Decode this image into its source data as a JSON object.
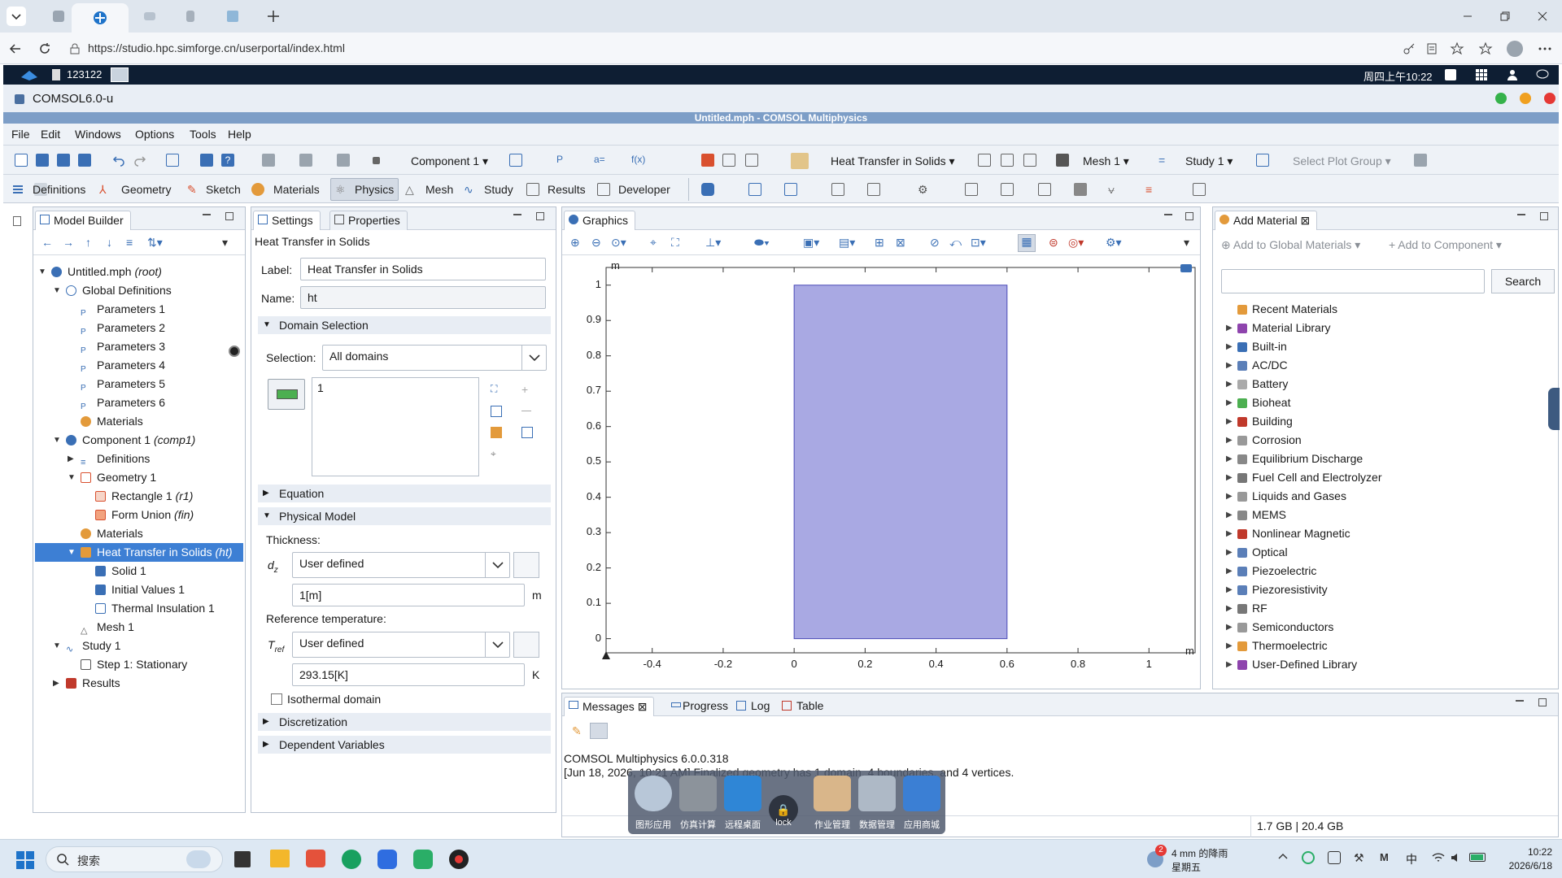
{
  "browser": {
    "url": "https://studio.hpc.simforge.cn/userportal/index.html"
  },
  "remote": {
    "session_id": "123122",
    "clock": "周四上午10:22"
  },
  "comsol_app": {
    "title": "COMSOL6.0-u",
    "window_title": "Untitled.mph - COMSOL Multiphysics"
  },
  "menu": {
    "items": [
      "File",
      "Edit",
      "Windows",
      "Options",
      "Tools",
      "Help"
    ]
  },
  "toolbar": {
    "component": "Component 1",
    "physics": "Heat Transfer in Solids",
    "mesh": "Mesh 1",
    "study": "Study 1",
    "plot_group": "Select Plot Group"
  },
  "ribbon": {
    "tabs": [
      "Definitions",
      "Geometry",
      "Sketch",
      "Materials",
      "Physics",
      "Mesh",
      "Study",
      "Results",
      "Developer"
    ]
  },
  "model_builder": {
    "title": "Model Builder",
    "tree": [
      {
        "text": "Untitled.mph",
        "em": "(root)"
      },
      {
        "text": "Global Definitions",
        "em": ""
      },
      {
        "text": "Parameters 1",
        "em": ""
      },
      {
        "text": "Parameters 2",
        "em": ""
      },
      {
        "text": "Parameters 3",
        "em": ""
      },
      {
        "text": "Parameters 4",
        "em": ""
      },
      {
        "text": "Parameters 5",
        "em": ""
      },
      {
        "text": "Parameters 6",
        "em": ""
      },
      {
        "text": "Materials",
        "em": ""
      },
      {
        "text": "Component 1",
        "em": "(comp1)"
      },
      {
        "text": "Definitions",
        "em": ""
      },
      {
        "text": "Geometry 1",
        "em": ""
      },
      {
        "text": "Rectangle 1",
        "em": "(r1)"
      },
      {
        "text": "Form Union",
        "em": "(fin)"
      },
      {
        "text": "Materials",
        "em": ""
      },
      {
        "text": "Heat Transfer in Solids",
        "em": "(ht)"
      },
      {
        "text": "Solid 1",
        "em": ""
      },
      {
        "text": "Initial Values 1",
        "em": ""
      },
      {
        "text": "Thermal Insulation 1",
        "em": ""
      },
      {
        "text": "Mesh 1",
        "em": ""
      },
      {
        "text": "Study 1",
        "em": ""
      },
      {
        "text": "Step 1: Stationary",
        "em": ""
      },
      {
        "text": "Results",
        "em": ""
      }
    ]
  },
  "settings": {
    "tab_settings": "Settings",
    "tab_properties": "Properties",
    "heading": "Heat Transfer in Solids",
    "label_caption": "Label:",
    "label_value": "Heat Transfer in Solids",
    "name_caption": "Name:",
    "name_value": "ht",
    "domain_selection": "Domain Selection",
    "selection_caption": "Selection:",
    "selection_value": "All domains",
    "selection_item": "1",
    "equation": "Equation",
    "physical_model": "Physical Model",
    "thickness": "Thickness:",
    "dz_symbol": "d",
    "dz_sub": "z",
    "dz_mode": "User defined",
    "dz_value": "1[m]",
    "dz_unit": "m",
    "reftemp": "Reference temperature:",
    "tref_symbol": "T",
    "tref_sub": "ref",
    "tref_mode": "User defined",
    "tref_value": "293.15[K]",
    "tref_unit": "K",
    "isothermal": "Isothermal domain",
    "discretization": "Discretization",
    "dependent_variables": "Dependent Variables"
  },
  "graphics": {
    "title": "Graphics",
    "unit_y": "m",
    "unit_x": "m",
    "y_ticks": [
      "1",
      "0.9",
      "0.8",
      "0.7",
      "0.6",
      "0.5",
      "0.4",
      "0.3",
      "0.2",
      "0.1",
      "0"
    ],
    "x_ticks": [
      "-0.4",
      "-0.2",
      "0",
      "0.2",
      "0.4",
      "0.6",
      "0.8",
      "1"
    ],
    "rect_fill": "#a9a9e3",
    "rect_stroke": "#4b4bb8"
  },
  "add_material": {
    "title": "Add Material",
    "add_global": "Add to Global Materials",
    "add_component": "Add to Component",
    "search_button": "Search",
    "items": [
      "Recent Materials",
      "Material Library",
      "Built-in",
      "AC/DC",
      "Battery",
      "Bioheat",
      "Building",
      "Corrosion",
      "Equilibrium Discharge",
      "Fuel Cell and Electrolyzer",
      "Liquids and Gases",
      "MEMS",
      "Nonlinear Magnetic",
      "Optical",
      "Piezoelectric",
      "Piezoresistivity",
      "RF",
      "Semiconductors",
      "Thermoelectric",
      "User-Defined Library"
    ]
  },
  "messages": {
    "tabs": [
      "Messages",
      "Progress",
      "Log",
      "Table"
    ],
    "line1": "COMSOL Multiphysics 6.0.0.318",
    "line2": "[Jun 18, 2026, 10:21 AM] Finalized geometry has 1 domain, 4 boundaries, and 4 vertices.",
    "memory": "1.7 GB | 20.4 GB"
  },
  "dock": {
    "labels": [
      "图形应用",
      "仿真计算",
      "远程桌面",
      "lock",
      "作业管理",
      "数据管理",
      "应用商城"
    ]
  },
  "taskbar": {
    "search": "搜索",
    "weather_badge": "2",
    "weather": "4 mm 的降雨",
    "weather_day": "星期五",
    "ime": "中",
    "time": "10:22",
    "date": "2026/6/18"
  }
}
